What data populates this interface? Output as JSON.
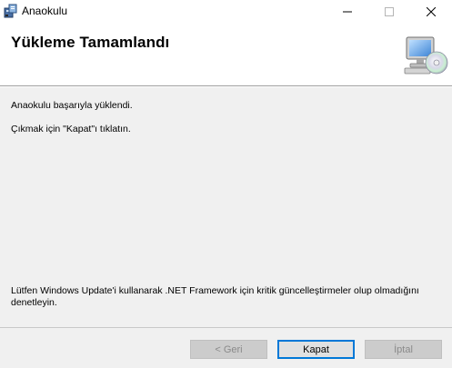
{
  "window": {
    "title": "Anaokulu"
  },
  "header": {
    "title": "Yükleme Tamamlandı",
    "icon": "computer-cd-icon"
  },
  "body": {
    "message_success": "Anaokulu başarıyla yüklendi.",
    "message_exit": "Çıkmak için \"Kapat\"ı tıklatın.",
    "message_update": "Lütfen Windows Update'i kullanarak .NET Framework için kritik güncelleştirmeler olup olmadığını denetleyin."
  },
  "buttons": {
    "back": "< Geri",
    "close": "Kapat",
    "cancel": "İptal"
  },
  "colors": {
    "dialog_bg": "#f0f0f0",
    "header_bg": "#ffffff",
    "accent": "#0078d7",
    "disabled_text": "#8a8a8a"
  }
}
